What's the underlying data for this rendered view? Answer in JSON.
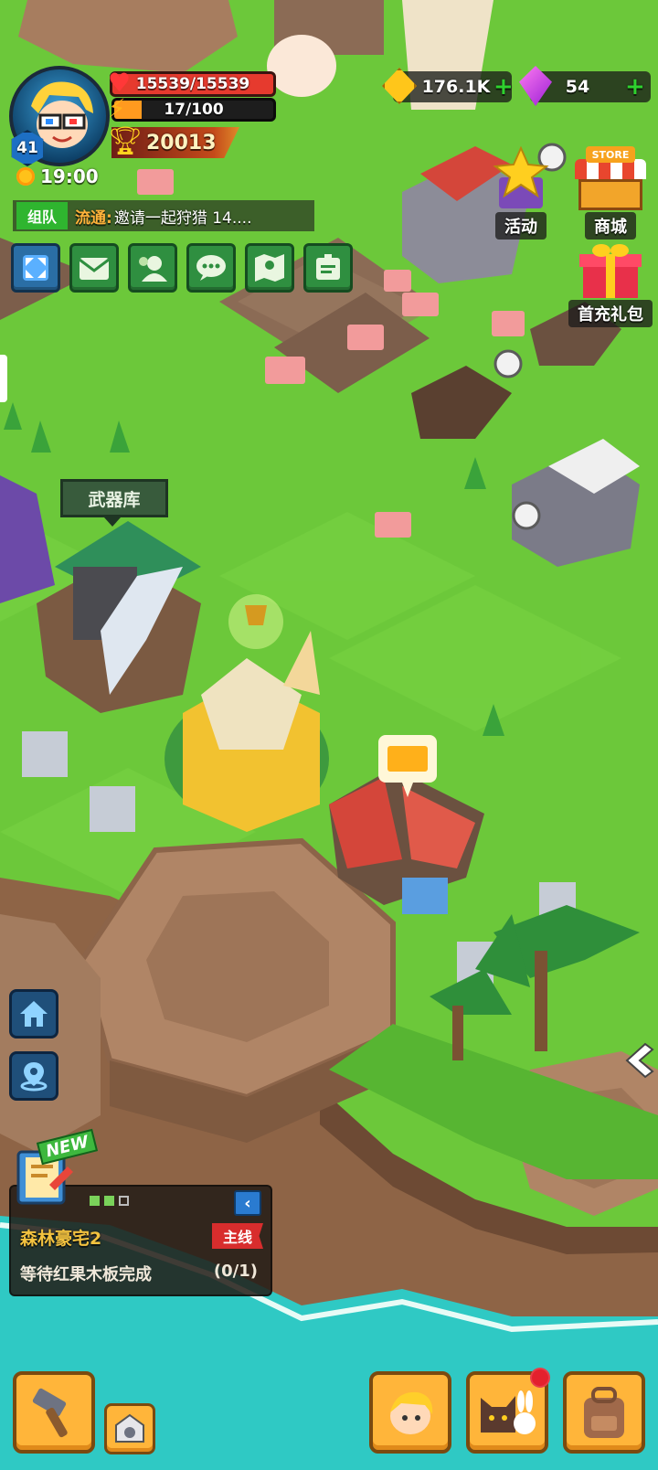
{
  "player": {
    "level": "41",
    "time": "19:00",
    "hp": "15539/15539",
    "stamina": "17/100",
    "stamina_fraction": 0.17,
    "power": "20013"
  },
  "currency": {
    "gold": "176.1K",
    "gems": "54"
  },
  "chat": {
    "team_tag": "组队",
    "channel": "流通:",
    "message": "邀请一起狩猎 14...."
  },
  "events": {
    "activity": "活动",
    "store": "商城",
    "store_sign": "STORE",
    "first_pack": "首充礼包"
  },
  "map": {
    "weapon_library": "武器库"
  },
  "quest": {
    "new_badge": "NEW",
    "title": "森林豪宅2",
    "tag": "主线",
    "description": "等待红果木板完成",
    "progress": "(0/1)"
  },
  "colors": {
    "grass": "#6cc83a",
    "water": "#2fc9c4",
    "cliff": "#a2775a",
    "accent": "#ffb53a"
  }
}
